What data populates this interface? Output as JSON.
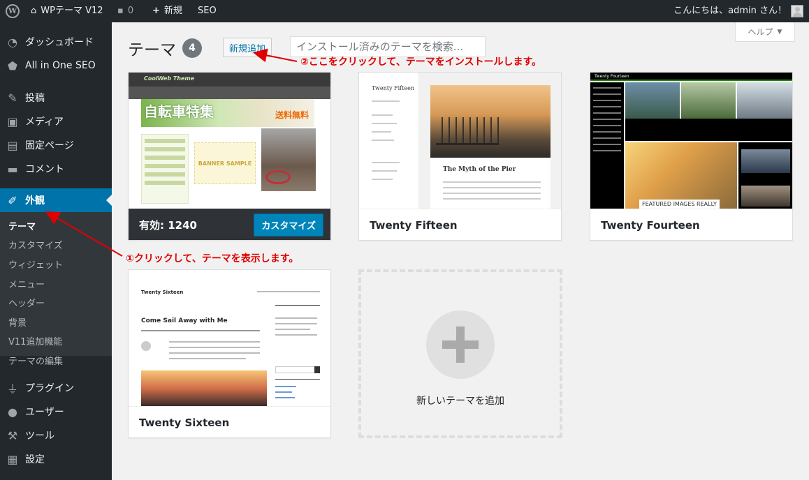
{
  "adminbar": {
    "site_name": "WPテーマ V12",
    "comments_count": "0",
    "new_label": "新規",
    "seo_label": "SEO",
    "greeting": "こんにちは、admin さん！"
  },
  "sidebar": {
    "items": [
      {
        "label": "ダッシュボード",
        "icon": "dashboard-icon"
      },
      {
        "label": "All in One SEO",
        "icon": "shield-icon"
      },
      {
        "label": "投稿",
        "icon": "pin-icon"
      },
      {
        "label": "メディア",
        "icon": "media-icon"
      },
      {
        "label": "固定ページ",
        "icon": "page-icon"
      },
      {
        "label": "コメント",
        "icon": "comment-icon"
      },
      {
        "label": "外観",
        "icon": "brush-icon"
      },
      {
        "label": "プラグイン",
        "icon": "plugin-icon"
      },
      {
        "label": "ユーザー",
        "icon": "user-icon"
      },
      {
        "label": "ツール",
        "icon": "wrench-icon"
      },
      {
        "label": "設定",
        "icon": "settings-icon"
      }
    ],
    "submenu": [
      "テーマ",
      "カスタマイズ",
      "ウィジェット",
      "メニュー",
      "ヘッダー",
      "背景",
      "V11追加機能",
      "テーマの編集"
    ]
  },
  "main": {
    "title": "テーマ",
    "count": "4",
    "add_new": "新規追加",
    "search_placeholder": "インストール済みのテーマを検索...",
    "help_label": "ヘルプ",
    "annotation_2": "②ここをクリックして、テーマをインストールします。",
    "annotation_1": "①クリックして、テーマを表示します。"
  },
  "themes": [
    {
      "active_label": "有効: 1240",
      "customize": "カスタマイズ",
      "shot": {
        "logo": "CoolWeb Theme",
        "banner": "自転車特集",
        "sale": "送料無料",
        "sample": "BANNER SAMPLE"
      }
    },
    {
      "name": "Twenty Fifteen",
      "shot": {
        "title": "Twenty Fifteen",
        "article": "The Myth of the Pier"
      }
    },
    {
      "name": "Twenty Fourteen",
      "shot": {
        "title": "Twenty Fourteen",
        "featured": "FEATURED IMAGES REALLY"
      }
    },
    {
      "name": "Twenty Sixteen",
      "shot": {
        "title": "Twenty Sixteen",
        "post": "Come Sail Away with Me"
      }
    }
  ],
  "add_theme_label": "新しいテーマを追加",
  "colors": {
    "adminbar": "#23282d",
    "accent": "#0073aa",
    "annotation": "#e00000"
  }
}
